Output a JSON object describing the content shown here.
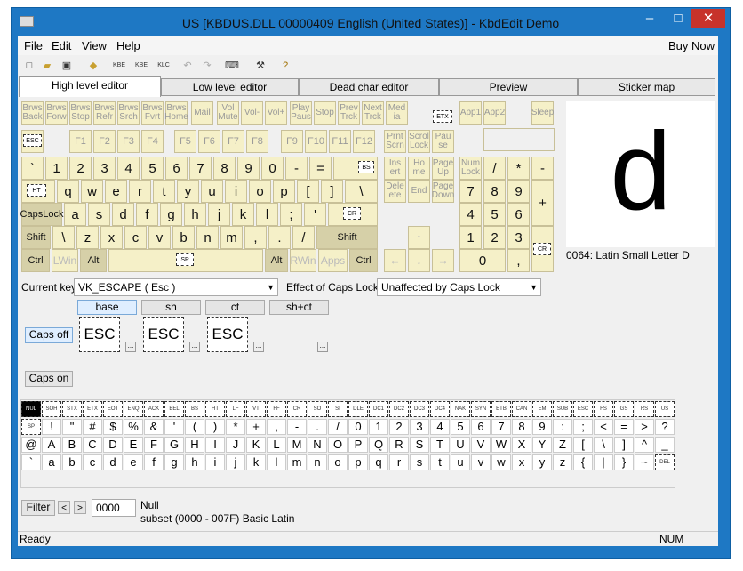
{
  "window": {
    "title": "US [KBDUS.DLL 00000409 English (United States)] - KbdEdit Demo",
    "min": "–",
    "max": "□",
    "close": "✕"
  },
  "menu": [
    "File",
    "Edit",
    "View",
    "Help"
  ],
  "buynow": "Buy Now",
  "toolbar": {
    "kbe": "KBE",
    "kbe2": "KBE",
    "klc": "KLC"
  },
  "tabs": [
    "High level editor",
    "Low level editor",
    "Dead char editor",
    "Preview",
    "Sticker map"
  ],
  "fkeys": {
    "row0": [
      "Brws Back",
      "Brws Forw",
      "Brws Stop",
      "Brws Refr",
      "Brws Srch",
      "Brws Fvrt",
      "Brws Home",
      "Mail",
      "Vol Mute",
      "Vol-",
      "Vol+",
      "Play Paus",
      "Stop",
      "Prev Trck",
      "Next Trck",
      "Med ia"
    ],
    "row0b": [
      "App1",
      "App2",
      "Sleep"
    ],
    "row1": [
      "F1",
      "F2",
      "F3",
      "F4",
      "F5",
      "F6",
      "F7",
      "F8",
      "F9",
      "F10",
      "F11",
      "F12"
    ],
    "nav1": [
      "Prnt Scrn",
      "Scrol Lock",
      "Pau se"
    ]
  },
  "main": {
    "r1": [
      "`",
      "1",
      "2",
      "3",
      "4",
      "5",
      "6",
      "7",
      "8",
      "9",
      "0",
      "-",
      "="
    ],
    "r2": [
      "q",
      "w",
      "e",
      "r",
      "t",
      "y",
      "u",
      "i",
      "o",
      "p",
      "[",
      "]"
    ],
    "r3": [
      "a",
      "s",
      "d",
      "f",
      "g",
      "h",
      "j",
      "k",
      "l",
      ";",
      "'"
    ],
    "r4": [
      "\\",
      "z",
      "x",
      "c",
      "v",
      "b",
      "n",
      "m",
      ",",
      ".",
      "/"
    ],
    "capslock": "CapsLock",
    "shift": "Shift",
    "shiftR": "Shift",
    "ctrl": "Ctrl",
    "lwin": "LWin",
    "alt": "Alt",
    "altR": "Alt",
    "rwin": "RWin",
    "apps": "Apps",
    "ctrlR": "Ctrl",
    "backslash": "\\"
  },
  "dashlabels": {
    "esc": "ESC",
    "bs": "BS",
    "ht": "HT",
    "cr": "CR",
    "sp": "SP",
    "etx": "ETX",
    "cr2": "CR"
  },
  "nav": {
    "ins": "Ins ert",
    "home": "Ho me",
    "pgup": "Page Up",
    "del": "Dele ete",
    "end": "End",
    "pgdn": "Page Down",
    "up": "↑",
    "left": "←",
    "down": "↓",
    "right": "→"
  },
  "numpad": {
    "numlock": "Num Lock",
    "div": "/",
    "mul": "*",
    "sub": "-",
    "n7": "7",
    "n8": "8",
    "n9": "9",
    "add": "+",
    "n4": "4",
    "n5": "5",
    "n6": "6",
    "n1": "1",
    "n2": "2",
    "n3": "3",
    "n0": "0",
    "dot": ","
  },
  "preview": {
    "char": "d",
    "desc": "0064: Latin Small Letter D"
  },
  "currentKey": {
    "label": "Current key",
    "value": "VK_ESCAPE ( Esc )"
  },
  "capsEffect": {
    "label": "Effect of Caps Lock",
    "value": "Unaffected by Caps Lock"
  },
  "shiftStates": [
    "base",
    "sh",
    "ct",
    "sh+ct"
  ],
  "capsOff": "Caps off",
  "capsOn": "Caps on",
  "bigKeys": [
    "ESC",
    "ESC",
    "ESC"
  ],
  "more": "...",
  "charmap": {
    "ctrl": [
      "NUL",
      "SOH",
      "STX",
      "ETX",
      "EOT",
      "ENQ",
      "ACK",
      "BEL",
      "BS",
      "HT",
      "LF",
      "VT",
      "FF",
      "CR",
      "SO",
      "SI",
      "DLE",
      "DC1",
      "DC2",
      "DC3",
      "DC4",
      "NAK",
      "SYN",
      "ETB",
      "CAN",
      "EM",
      "SUB",
      "ESC",
      "FS",
      "GS",
      "RS",
      "US"
    ],
    "r1": [
      "SP",
      "!",
      "\"",
      "#",
      "$",
      "%",
      "&",
      "'",
      "(",
      ")",
      "*",
      "+",
      ",",
      "-",
      ".",
      "/",
      "0",
      "1",
      "2",
      "3",
      "4",
      "5",
      "6",
      "7",
      "8",
      "9",
      ":",
      ";",
      "<",
      "=",
      ">",
      "?"
    ],
    "r2": [
      "@",
      "A",
      "B",
      "C",
      "D",
      "E",
      "F",
      "G",
      "H",
      "I",
      "J",
      "K",
      "L",
      "M",
      "N",
      "O",
      "P",
      "Q",
      "R",
      "S",
      "T",
      "U",
      "V",
      "W",
      "X",
      "Y",
      "Z",
      "[",
      "\\",
      "]",
      "^",
      "_"
    ],
    "r3": [
      "`",
      "a",
      "b",
      "c",
      "d",
      "e",
      "f",
      "g",
      "h",
      "i",
      "j",
      "k",
      "l",
      "m",
      "n",
      "o",
      "p",
      "q",
      "r",
      "s",
      "t",
      "u",
      "v",
      "w",
      "x",
      "y",
      "z",
      "{",
      "|",
      "}",
      "~",
      "DEL"
    ]
  },
  "filter": {
    "label": "Filter",
    "prev": "<",
    "next": ">",
    "code": "0000",
    "name": "Null",
    "subset": "subset (0000 - 007F) Basic Latin"
  },
  "status": {
    "left": "Ready",
    "right": "NUM"
  },
  "colors": {
    "title": "#1e78c4",
    "key": "#f5f0c8",
    "dead": "#d6d0a8"
  }
}
